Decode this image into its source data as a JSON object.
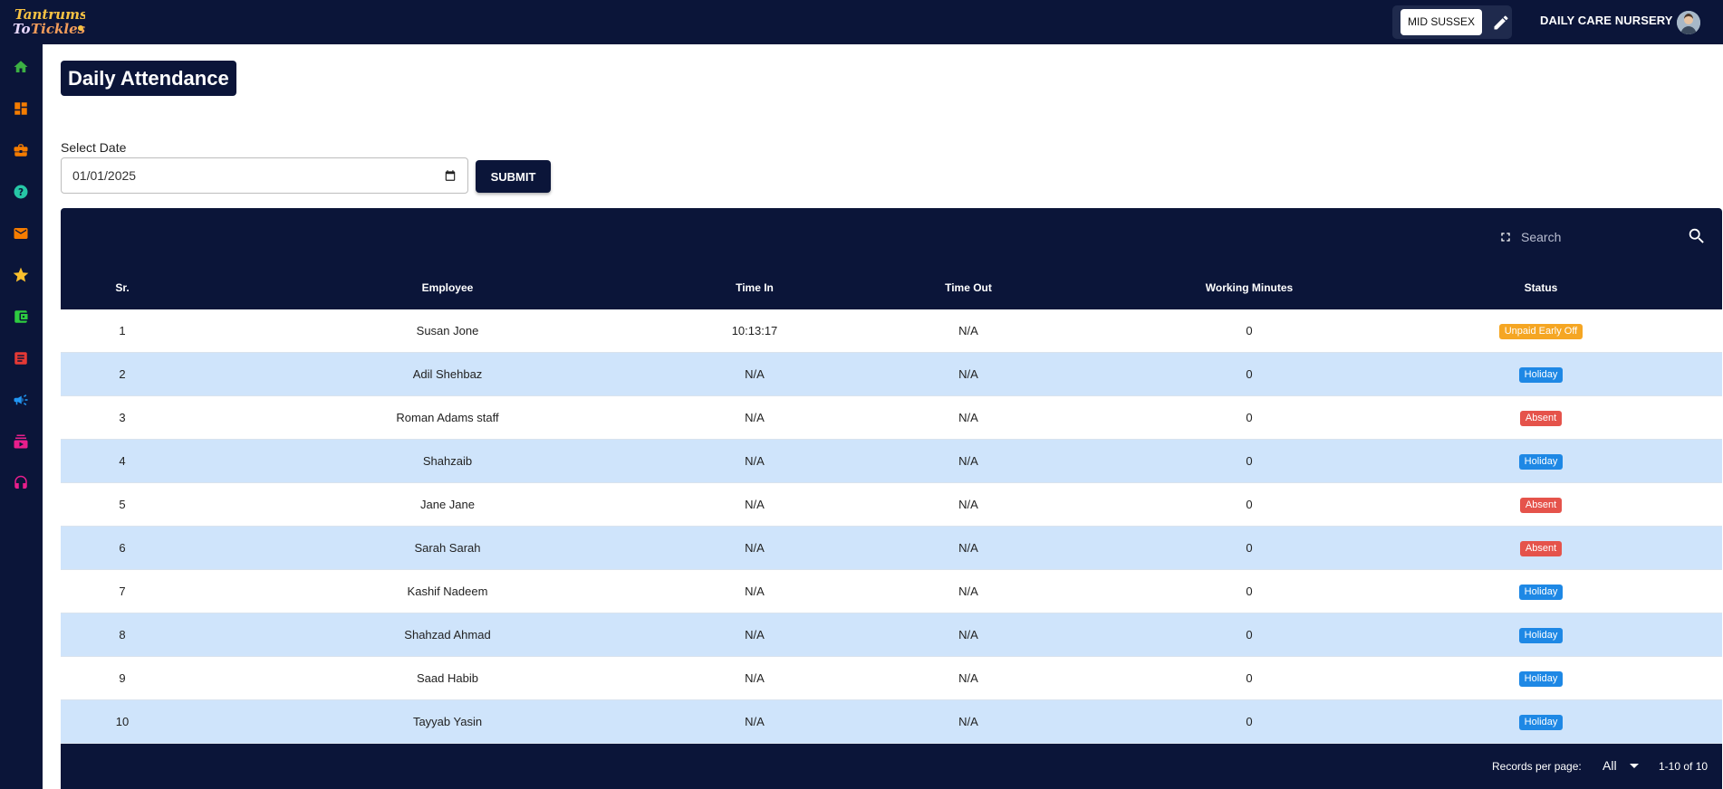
{
  "header": {
    "logo_text": "Tantrums To Tickles",
    "branch": "MID SUSSEX",
    "nursery_name": "DAILY CARE NURSERY"
  },
  "sidebar": {
    "items": [
      {
        "name": "home-icon",
        "color": "#3cb043"
      },
      {
        "name": "dashboard-icon",
        "color": "#f57c00"
      },
      {
        "name": "briefcase-icon",
        "color": "#f57c00"
      },
      {
        "name": "help-icon",
        "color": "#26c6a6"
      },
      {
        "name": "mail-icon",
        "color": "#f57c00"
      },
      {
        "name": "star-icon",
        "color": "#fbc02d"
      },
      {
        "name": "wallet-icon",
        "color": "#2ecc40"
      },
      {
        "name": "document-icon",
        "color": "#e53935"
      },
      {
        "name": "megaphone-icon",
        "color": "#2196f3"
      },
      {
        "name": "layers-icon",
        "color": "#e91e8c"
      },
      {
        "name": "headset-icon",
        "color": "#e91e8c"
      }
    ]
  },
  "page": {
    "title": "Daily Attendance",
    "date_label": "Select Date",
    "date_value": "01/01/2025",
    "submit_label": "SUBMIT"
  },
  "table": {
    "search_placeholder": "Search",
    "columns": [
      "Sr.",
      "Employee",
      "Time In",
      "Time Out",
      "Working Minutes",
      "Status"
    ],
    "rows": [
      {
        "sr": "1",
        "employee": "Susan Jone",
        "time_in": "10:13:17",
        "time_out": "N/A",
        "minutes": "0",
        "status": "Unpaid Early Off",
        "status_color": "#f5a623"
      },
      {
        "sr": "2",
        "employee": "Adil Shehbaz",
        "time_in": "N/A",
        "time_out": "N/A",
        "minutes": "0",
        "status": "Holiday",
        "status_color": "#1e88e5"
      },
      {
        "sr": "3",
        "employee": "Roman Adams staff",
        "time_in": "N/A",
        "time_out": "N/A",
        "minutes": "0",
        "status": "Absent",
        "status_color": "#e5534b"
      },
      {
        "sr": "4",
        "employee": "Shahzaib",
        "time_in": "N/A",
        "time_out": "N/A",
        "minutes": "0",
        "status": "Holiday",
        "status_color": "#1e88e5"
      },
      {
        "sr": "5",
        "employee": "Jane Jane",
        "time_in": "N/A",
        "time_out": "N/A",
        "minutes": "0",
        "status": "Absent",
        "status_color": "#e5534b"
      },
      {
        "sr": "6",
        "employee": "Sarah Sarah",
        "time_in": "N/A",
        "time_out": "N/A",
        "minutes": "0",
        "status": "Absent",
        "status_color": "#e5534b"
      },
      {
        "sr": "7",
        "employee": "Kashif Nadeem",
        "time_in": "N/A",
        "time_out": "N/A",
        "minutes": "0",
        "status": "Holiday",
        "status_color": "#1e88e5"
      },
      {
        "sr": "8",
        "employee": "Shahzad Ahmad",
        "time_in": "N/A",
        "time_out": "N/A",
        "minutes": "0",
        "status": "Holiday",
        "status_color": "#1e88e5"
      },
      {
        "sr": "9",
        "employee": "Saad Habib",
        "time_in": "N/A",
        "time_out": "N/A",
        "minutes": "0",
        "status": "Holiday",
        "status_color": "#1e88e5"
      },
      {
        "sr": "10",
        "employee": "Tayyab Yasin",
        "time_in": "N/A",
        "time_out": "N/A",
        "minutes": "0",
        "status": "Holiday",
        "status_color": "#1e88e5"
      }
    ],
    "footer": {
      "records_per_page_label": "Records per page:",
      "records_per_page_value": "All",
      "range_text": "1-10 of 10"
    }
  }
}
